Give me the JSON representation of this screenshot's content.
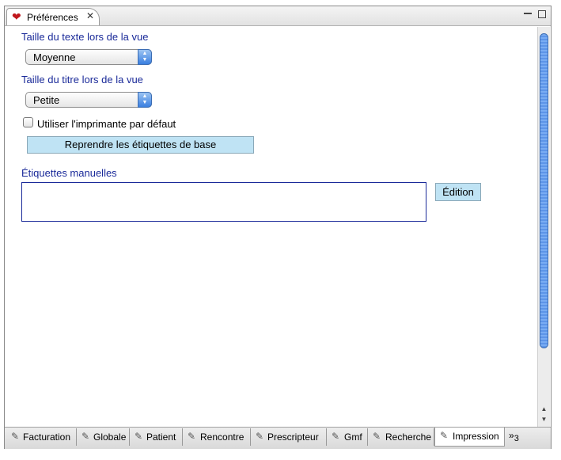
{
  "view": {
    "title": "Préférences",
    "icon": "heart-icon",
    "close_glyph": "✕"
  },
  "fields": {
    "text_size_label": "Taille du texte lors de la vue",
    "text_size_value": "Moyenne",
    "title_size_label": "Taille du titre lors de la vue",
    "title_size_value": "Petite",
    "default_printer_label": "Utiliser l'imprimante par défaut",
    "default_printer_checked": false,
    "reset_labels_button": "Reprendre les étiquettes de base",
    "manual_labels_label": "Étiquettes manuelles",
    "manual_labels_value": "",
    "edit_button": "Édition"
  },
  "tabs": [
    {
      "label": "Facturation",
      "active": false
    },
    {
      "label": "Globale",
      "active": false
    },
    {
      "label": "Patient",
      "active": false
    },
    {
      "label": "Rencontre",
      "active": false
    },
    {
      "label": "Prescripteur",
      "active": false
    },
    {
      "label": "Gmf",
      "active": false
    },
    {
      "label": "Recherche",
      "active": false
    },
    {
      "label": "Impression",
      "active": true
    }
  ],
  "more_tabs": {
    "glyph": "»",
    "count": "3"
  },
  "colors": {
    "label_blue": "#1a2a99",
    "button_blue": "#bfe3f4",
    "heart_red": "#c0171d",
    "scroll_blue": "#5d95e8"
  }
}
